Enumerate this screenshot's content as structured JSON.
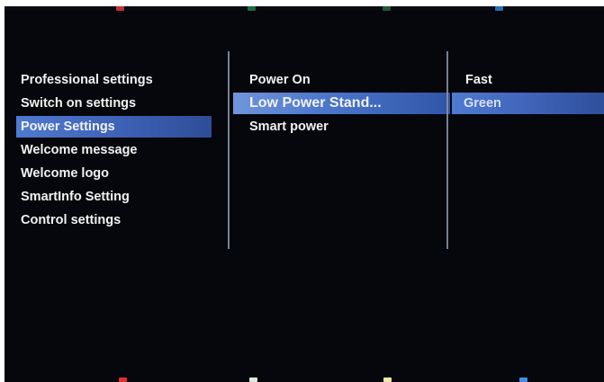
{
  "menu": {
    "left": [
      {
        "label": "Professional settings",
        "selected": false
      },
      {
        "label": "Switch on settings",
        "selected": false
      },
      {
        "label": "Power Settings",
        "selected": true
      },
      {
        "label": "Welcome message",
        "selected": false
      },
      {
        "label": "Welcome logo",
        "selected": false
      },
      {
        "label": "SmartInfo Setting",
        "selected": false
      },
      {
        "label": "Control settings",
        "selected": false
      }
    ],
    "middle": [
      {
        "label": "Power On",
        "selected": false
      },
      {
        "label": "Low Power Stand...",
        "selected": true
      },
      {
        "label": "Smart power",
        "selected": false
      }
    ],
    "right": [
      {
        "label": "Fast",
        "selected": false
      },
      {
        "label": "Green",
        "selected": true
      }
    ]
  },
  "colors": {
    "screen_background": "#05070c",
    "selection": "#4a72c6",
    "divider": "#8b97aa",
    "color_keys": [
      "#e03030",
      "#dfe8dc",
      "#f2e7a8",
      "#3f8fe6"
    ]
  }
}
